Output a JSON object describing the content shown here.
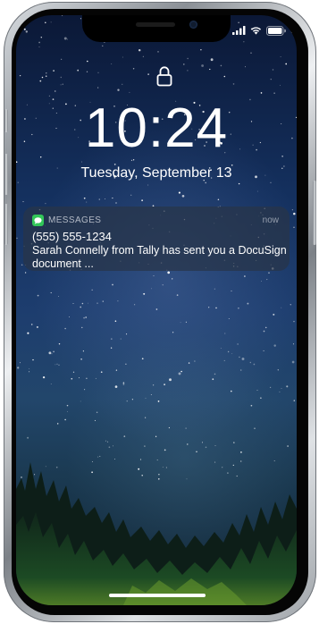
{
  "lock_screen": {
    "time": "10:24",
    "date": "Tuesday, September 13"
  },
  "notification": {
    "app_name": "MESSAGES",
    "timestamp": "now",
    "title": "(555) 555-1234",
    "body": "Sarah Connelly from Tally has sent you a DocuSign document ...",
    "app_icon": "message-bubble-icon"
  },
  "status_bar": {
    "icons": [
      "signal-icon",
      "wifi-icon",
      "battery-icon"
    ]
  },
  "colors": {
    "messages_green": "#33c759",
    "notification_background": "#283448",
    "text": "#ffffff"
  }
}
